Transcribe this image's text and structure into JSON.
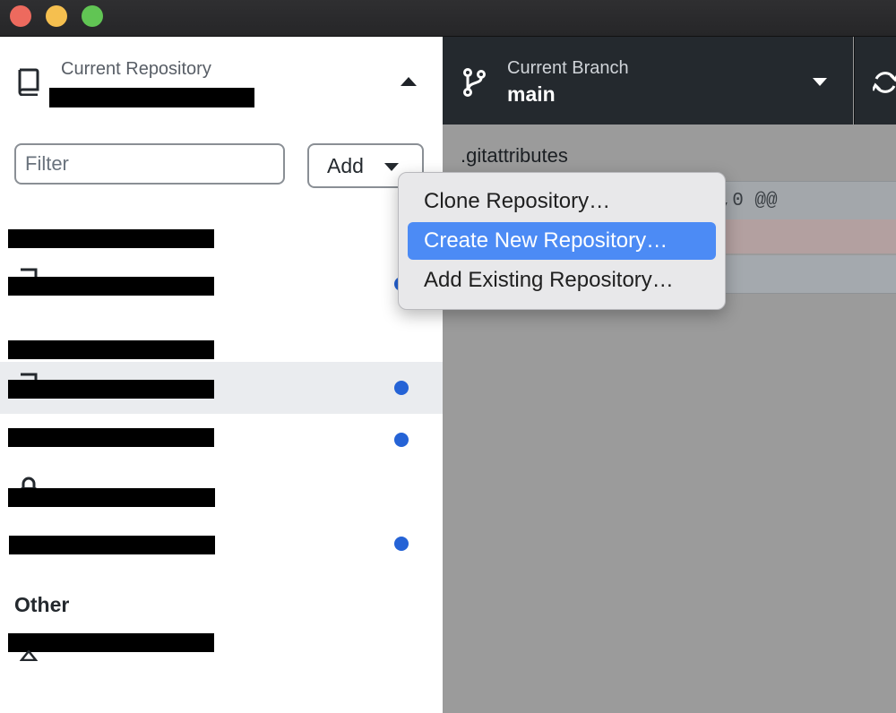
{
  "window": {
    "traffic_lights": {
      "close_color": "#ed6a5e",
      "minimize_color": "#f5bf4f",
      "zoom_color": "#61c554"
    }
  },
  "toolbar": {
    "repository": {
      "caption": "Current Repository",
      "name_redacted": true,
      "icon": "repo-icon",
      "expanded_icon": "caret-up-icon"
    },
    "branch": {
      "caption": "Current Branch",
      "name": "main",
      "icon": "git-branch-icon",
      "dropdown_icon": "caret-down-icon"
    },
    "fetch": {
      "icon": "sync-icon"
    }
  },
  "sidebar": {
    "filter": {
      "placeholder": "Filter",
      "value": ""
    },
    "add_button": {
      "label": "Add",
      "icon": "caret-down-icon"
    },
    "groups": [
      {
        "label_redacted": true,
        "repos": [
          {
            "redacted": true,
            "has_changes": true
          }
        ]
      },
      {
        "label_redacted": true,
        "repos": [
          {
            "redacted": true,
            "selected": true,
            "has_changes": true
          },
          {
            "redacted": true,
            "has_changes": true
          },
          {
            "redacted": true,
            "has_changes": false,
            "icon": "lock-icon"
          },
          {
            "redacted": true,
            "has_changes": true
          }
        ]
      },
      {
        "label": "Other",
        "repos": [
          {
            "redacted": true,
            "has_changes": false
          }
        ]
      }
    ],
    "change_dot_color": "#2563d6"
  },
  "diff": {
    "file": ".gitattributes",
    "hunk_header": "0,0 @@"
  },
  "add_menu": {
    "items": [
      {
        "label": "Clone Repository…",
        "highlighted": false
      },
      {
        "label": "Create New Repository…",
        "highlighted": true
      },
      {
        "label": "Add Existing Repository…",
        "highlighted": false
      }
    ],
    "highlight_color": "#4c8bf5"
  }
}
